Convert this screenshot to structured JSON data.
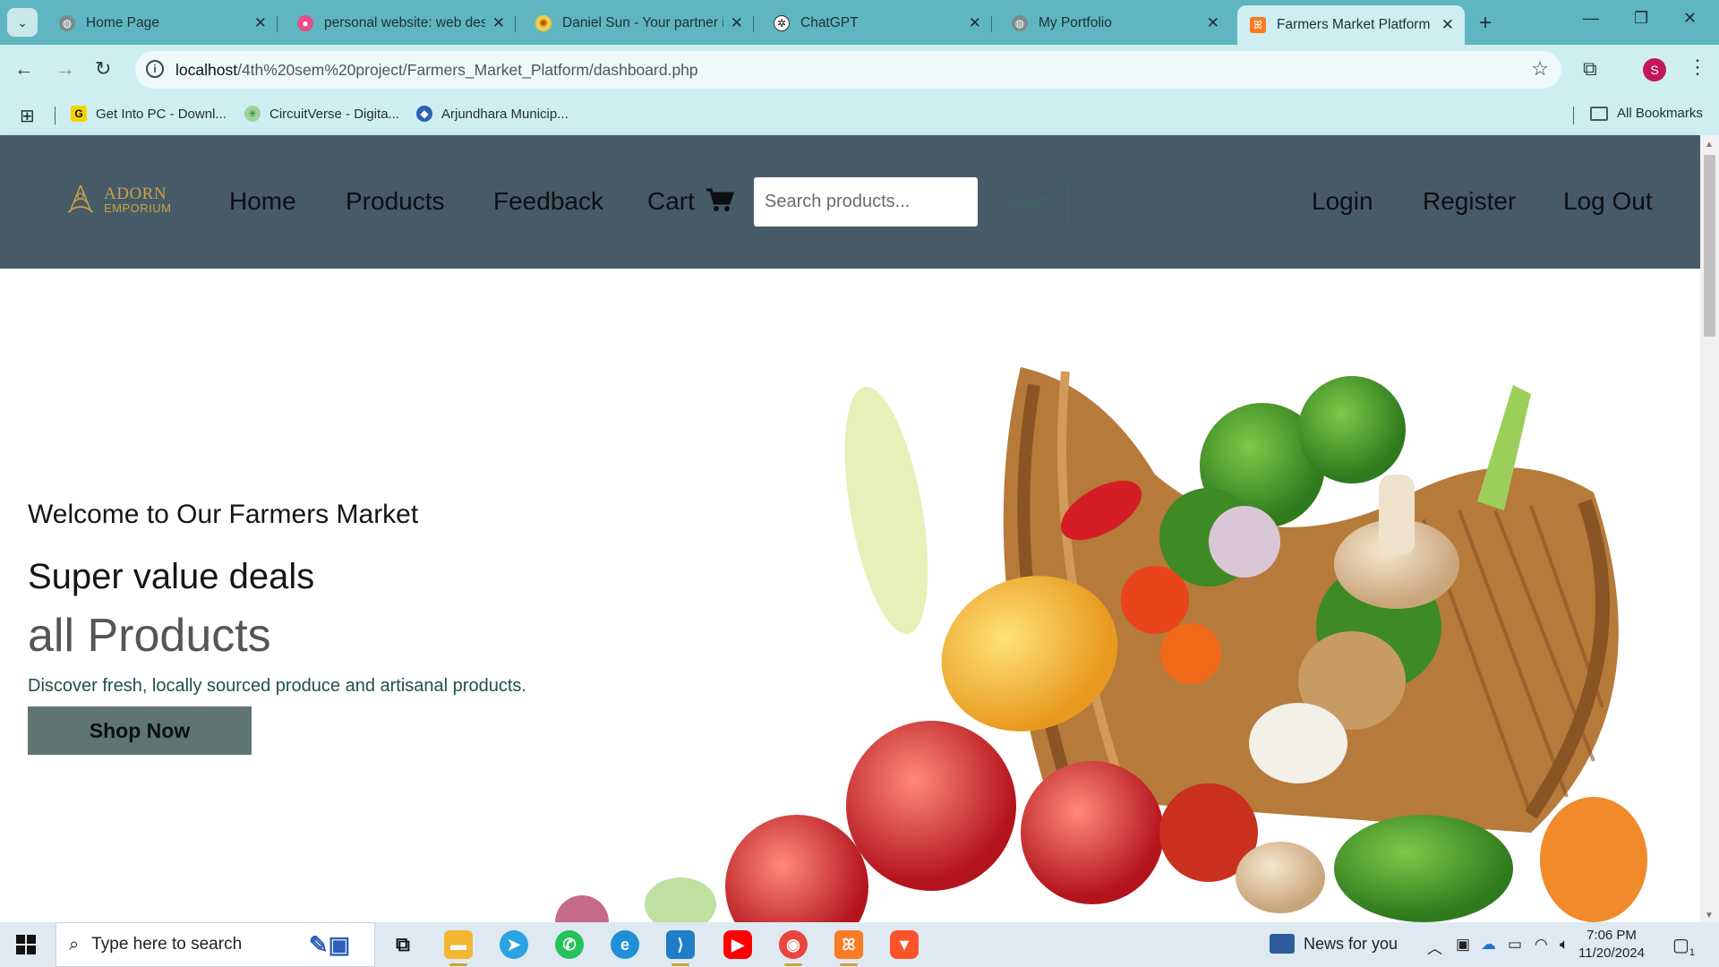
{
  "browser": {
    "tabs": [
      {
        "title": "Home Page",
        "icon": "globe-icon",
        "active": false
      },
      {
        "title": "personal website: web desi",
        "icon": "dribbble-icon",
        "active": false
      },
      {
        "title": "Daniel Sun - Your partner i",
        "icon": "sun-icon",
        "active": false
      },
      {
        "title": "ChatGPT",
        "icon": "chatgpt-icon",
        "active": false
      },
      {
        "title": "My Portfolio",
        "icon": "globe-icon",
        "active": false
      },
      {
        "title": "Farmers Market Platform",
        "icon": "xampp-icon",
        "active": true
      }
    ],
    "address": {
      "host": "localhost",
      "path": "/4th%20sem%20project/Farmers_Market_Platform/dashboard.php"
    },
    "profile_initial": "S",
    "bookmarks": [
      {
        "label": "Get Into PC - Downl...",
        "icon": "getintopc-icon"
      },
      {
        "label": "CircuitVerse - Digita...",
        "icon": "circuitverse-icon"
      },
      {
        "label": "Arjundhara Municip...",
        "icon": "arjundhara-icon"
      }
    ],
    "all_bookmarks_label": "All Bookmarks"
  },
  "site": {
    "logo": {
      "line1": "ADORN",
      "line2": "EMPORIUM"
    },
    "nav": {
      "home": "Home",
      "products": "Products",
      "feedback": "Feedback",
      "cart": "Cart",
      "login": "Login",
      "register": "Register",
      "logout": "Log Out"
    },
    "search": {
      "placeholder": "Search products...",
      "button": "Search"
    },
    "hero": {
      "welcome": "Welcome to Our Farmers Market",
      "deals": "Super value deals",
      "products": "all Products",
      "description": "Discover fresh, locally sourced produce and artisanal products.",
      "cta": "Shop Now"
    }
  },
  "taskbar": {
    "search_placeholder": "Type here to search",
    "news": "News for you",
    "time": "7:06 PM",
    "date": "11/20/2024",
    "notification_count": "1"
  },
  "colors": {
    "tabstrip": "#5fb6c0",
    "toolbar": "#cfeef2",
    "site_header": "#475a68",
    "logo_gold": "#c9a349",
    "shop_button": "#5e7574"
  }
}
